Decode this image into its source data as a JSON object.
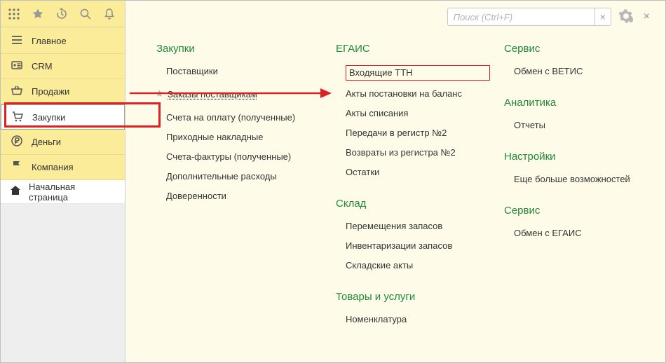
{
  "toolbar_icons": [
    "grid",
    "star",
    "history",
    "search",
    "bell"
  ],
  "sidebar": {
    "items": [
      {
        "label": "Главное"
      },
      {
        "label": "CRM"
      },
      {
        "label": "Продажи"
      },
      {
        "label": "Закупки"
      },
      {
        "label": "Деньги"
      },
      {
        "label": "Компания"
      }
    ],
    "start_page": "Начальная страница"
  },
  "search": {
    "placeholder": "Поиск (Ctrl+F)",
    "clear": "×",
    "close": "×"
  },
  "content": {
    "col1": {
      "sec1_title": "Закупки",
      "sec1_links": [
        "Поставщики",
        "Заказы поставщикам",
        "Счета на оплату (полученные)",
        "Приходные накладные",
        "Счета-фактуры (полученные)",
        "Дополнительные расходы",
        "Доверенности"
      ]
    },
    "col2": {
      "sec1_title": "ЕГАИС",
      "sec1_links": [
        "Входящие ТТН",
        "Акты постановки на баланс",
        "Акты списания",
        "Передачи в регистр №2",
        "Возвраты из регистра №2",
        "Остатки"
      ],
      "sec2_title": "Склад",
      "sec2_links": [
        "Перемещения запасов",
        "Инвентаризации запасов",
        "Складские акты"
      ],
      "sec3_title": "Товары и услуги",
      "sec3_links": [
        "Номенклатура"
      ]
    },
    "col3": {
      "sec1_title": "Сервис",
      "sec1_links": [
        "Обмен с ВЕТИС"
      ],
      "sec2_title": "Аналитика",
      "sec2_links": [
        "Отчеты"
      ],
      "sec3_title": "Настройки",
      "sec3_links": [
        "Еще больше возможностей"
      ],
      "sec4_title": "Сервис",
      "sec4_links": [
        "Обмен с ЕГАИС"
      ]
    }
  }
}
